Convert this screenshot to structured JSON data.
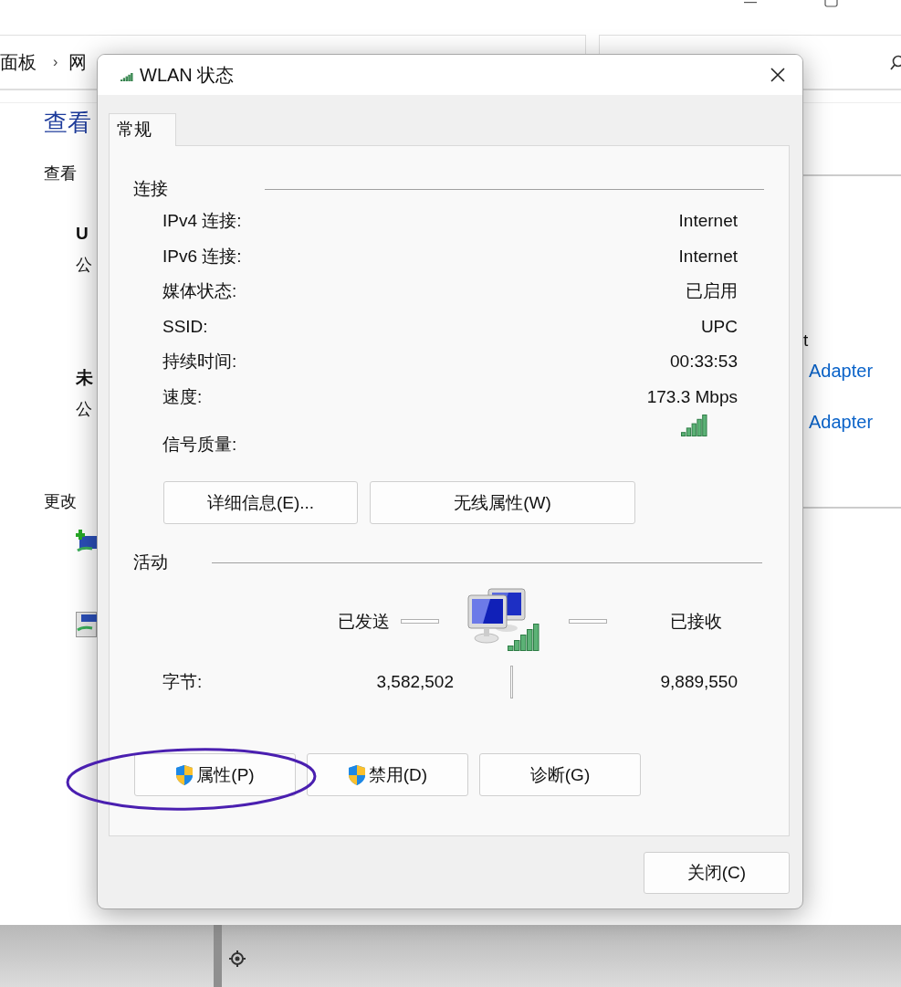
{
  "background_window": {
    "breadcrumb": [
      "面板",
      "›",
      "网"
    ],
    "heading": "查看",
    "subheading": "查看",
    "networks": [
      {
        "name": "U",
        "type": "公"
      },
      {
        "name": "未",
        "type": "公"
      }
    ],
    "section": "更改",
    "right_texts": [
      {
        "text": "t",
        "kind": "plain"
      },
      {
        "text": "Adapter",
        "kind": "link"
      },
      {
        "text": "Adapter",
        "kind": "link"
      }
    ]
  },
  "dialog": {
    "title": "WLAN 状态",
    "tabs": [
      {
        "label": "常规",
        "selected": true
      }
    ],
    "connection": {
      "label": "连接",
      "rows": [
        {
          "label": "IPv4 连接:",
          "value": "Internet",
          "kind": "text"
        },
        {
          "label": "IPv6 连接:",
          "value": "Internet",
          "kind": "text"
        },
        {
          "label": "媒体状态:",
          "value": "已启用",
          "kind": "text"
        },
        {
          "label": "SSID:",
          "value": "UPC",
          "kind": "text"
        },
        {
          "label": "持续时间:",
          "value": "00:33:53",
          "kind": "text"
        },
        {
          "label": "速度:",
          "value": "173.3 Mbps",
          "kind": "text"
        },
        {
          "label": "信号质量:",
          "kind": "signal"
        }
      ]
    },
    "detail_buttons": [
      "详细信息(E)...",
      "无线属性(W)"
    ],
    "activity": {
      "label": "活动",
      "sent_label": "已发送",
      "received_label": "已接收",
      "bytes_label": "字节:",
      "bytes_sent": "3,582,502",
      "bytes_received": "9,889,550"
    },
    "action_buttons": [
      {
        "label": "属性(P)",
        "shield": true,
        "circled": true
      },
      {
        "label": "禁用(D)",
        "shield": true,
        "circled": false
      },
      {
        "label": "诊断(G)",
        "shield": false,
        "circled": false
      }
    ],
    "close_button": "关闭(C)"
  }
}
